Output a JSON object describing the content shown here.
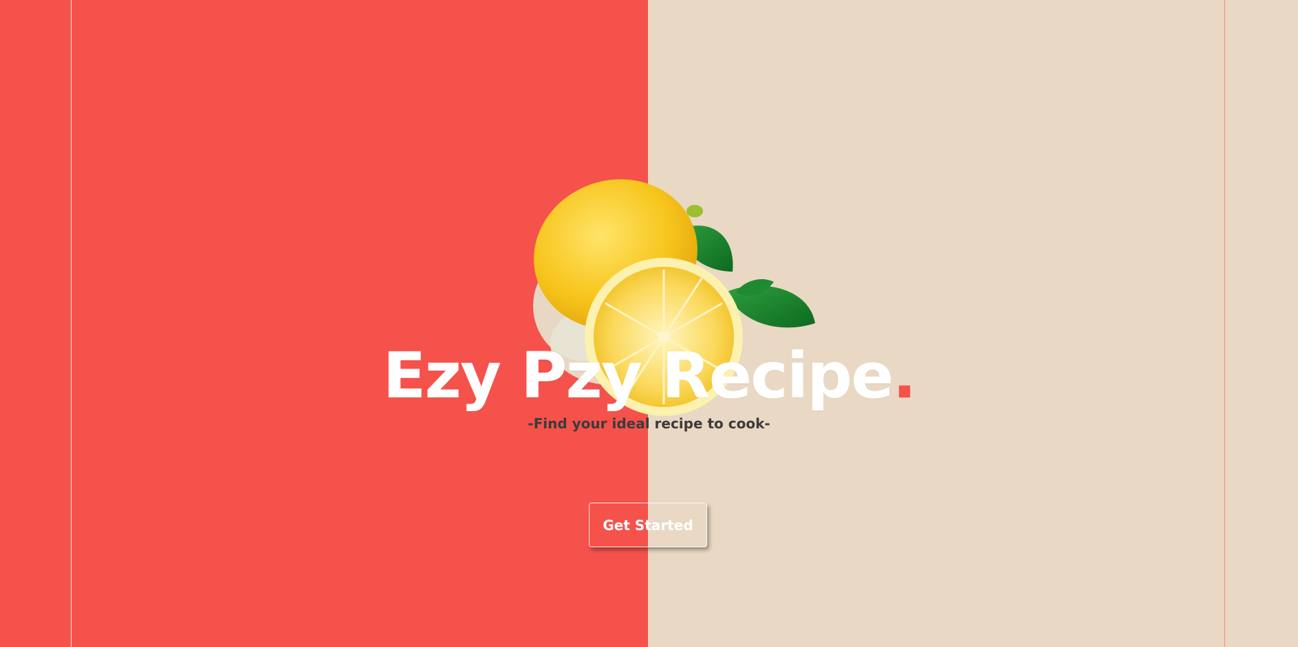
{
  "hero": {
    "title": "Ezy Pzy Recipe",
    "title_dot": ".",
    "tagline": "-Find your ideal recipe to cook-",
    "cta_label": "Get Started"
  },
  "colors": {
    "left_panel": "#f5524c",
    "right_panel": "#e9d8c3",
    "accent": "#f5524c",
    "title": "#ffffff",
    "tagline": "#3b3b3b"
  },
  "image": {
    "subject": "lemon-with-leaves"
  }
}
